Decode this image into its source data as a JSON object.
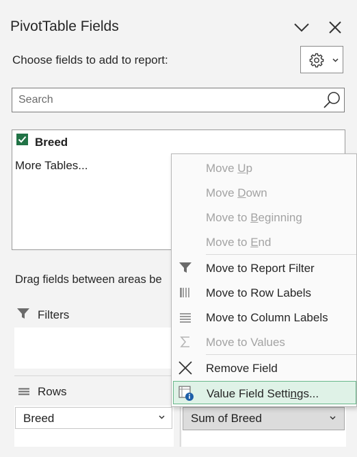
{
  "panel": {
    "title": "PivotTable Fields",
    "choose_text": "Choose fields to add to report:",
    "drag_text": "Drag fields between areas be"
  },
  "search": {
    "placeholder": "Search"
  },
  "field_list": {
    "fields": [
      {
        "label": "Breed",
        "checked": true
      }
    ],
    "more_tables": "More Tables..."
  },
  "areas": {
    "filters": {
      "label": "Filters"
    },
    "rows": {
      "label": "Rows",
      "items": [
        "Breed"
      ]
    },
    "values": {
      "items": [
        "Sum of Breed"
      ]
    }
  },
  "context_menu": {
    "items": [
      {
        "pre": "Move ",
        "key": "U",
        "post": "p",
        "enabled": false
      },
      {
        "pre": "Move ",
        "key": "D",
        "post": "own",
        "enabled": false
      },
      {
        "pre": "Move to ",
        "key": "B",
        "post": "eginning",
        "enabled": false
      },
      {
        "pre": "Move to ",
        "key": "E",
        "post": "nd",
        "enabled": false
      },
      {
        "label": "Move to Report Filter",
        "icon": "filter-icon",
        "enabled": true
      },
      {
        "label": "Move to Row Labels",
        "icon": "row-labels-icon",
        "enabled": true
      },
      {
        "label": "Move to Column Labels",
        "icon": "column-labels-icon",
        "enabled": true
      },
      {
        "label": "Move to Values",
        "icon": "sigma-icon",
        "enabled": false
      },
      {
        "label": "Remove Field",
        "icon": "remove-x-icon",
        "enabled": true
      },
      {
        "pre": "Value Field Setti",
        "key": "n",
        "post": "gs...",
        "icon": "field-settings-icon",
        "enabled": true,
        "highlighted": true
      }
    ]
  },
  "colors": {
    "accent": "#217346",
    "highlight_bg": "#dff2e7",
    "highlight_border": "#69b88a",
    "disabled_text": "#a3a3a3"
  }
}
